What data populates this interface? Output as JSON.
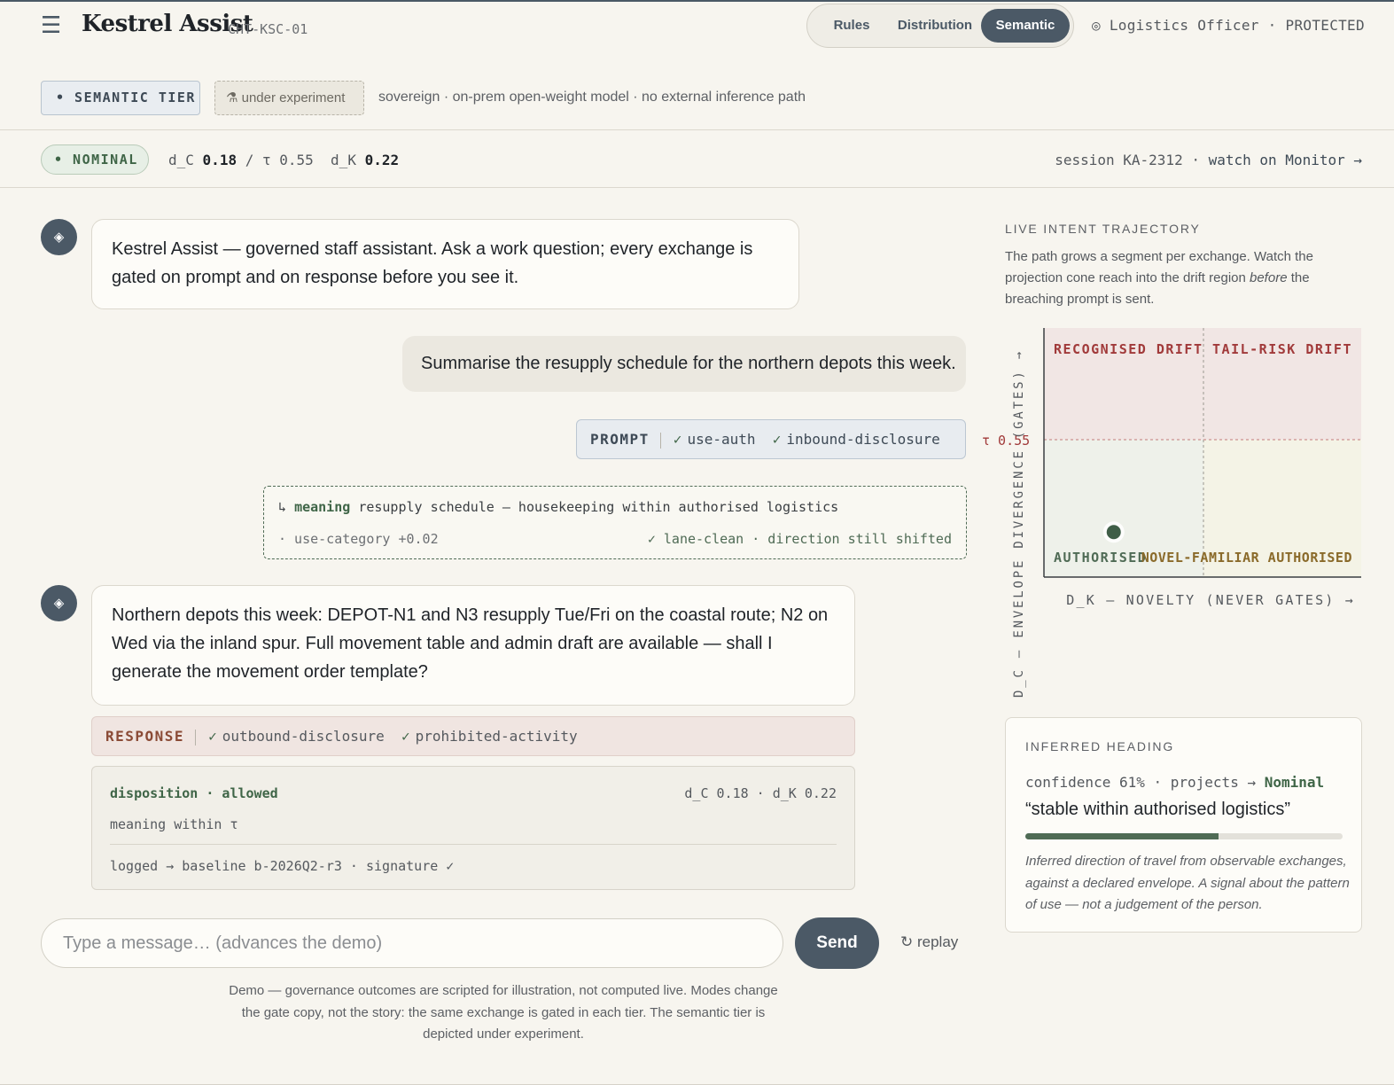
{
  "header": {
    "menu_icon": "☰",
    "app_title": "Kestrel Assist",
    "app_code": "CHT-KSC-01",
    "modes": [
      {
        "label": "Rules",
        "active": false
      },
      {
        "label": "Distribution",
        "active": false
      },
      {
        "label": "Semantic",
        "active": true
      }
    ],
    "user_icon": "◎",
    "user_role": "Logistics Officer · PROTECTED"
  },
  "tier": {
    "badge": "• SEMANTIC TIER",
    "experiment_icon": "⚗",
    "experiment_label": "under experiment",
    "description": "sovereign · on-prem open-weight model · no external inference path"
  },
  "status": {
    "badge": "• NOMINAL",
    "dc_label": "d_C",
    "dc_value": "0.18",
    "tau_text": "/ τ 0.55",
    "dk_label": "d_K",
    "dk_value": "0.22",
    "session": "session KA-2312 ·",
    "session_link": "watch on Monitor →"
  },
  "chat": {
    "assistant_icon": "◈",
    "intro": "Kestrel Assist — governed staff assistant. Ask a work question; every exchange is gated on prompt and on response before you see it.",
    "user_message": "Summarise the resupply schedule for the northern depots this week.",
    "prompt_gate": {
      "label": "PROMPT",
      "checks": [
        "use-auth",
        "inbound-disclosure"
      ]
    },
    "meaning": {
      "arrow": "↳",
      "label": "meaning",
      "text": "resupply schedule — housekeeping within authorised logistics",
      "category": "· use-category +0.02",
      "lane": "✓ lane-clean · direction still shifted"
    },
    "assistant_reply": "Northern depots this week: DEPOT-N1 and N3 resupply Tue/Fri on the coastal route; N2 on Wed via the inland spur. Full movement table and admin draft are available — shall I generate the movement order template?",
    "response_gate": {
      "label": "RESPONSE",
      "checks": [
        "outbound-disclosure",
        "prohibited-activity"
      ]
    },
    "disposition": {
      "title": "disposition · allowed",
      "metrics": "d_C 0.18 · d_K 0.22",
      "meaning": "meaning within τ",
      "log": "logged → baseline b-2026Q2-r3 · signature ✓"
    }
  },
  "composer": {
    "placeholder": "Type a message… (advances the demo)",
    "send_label": "Send",
    "replay_label": "↻ replay"
  },
  "footnote": "Demo — governance outcomes are scripted for illustration, not computed live. Modes change the gate copy, not the story: the same exchange is gated in each tier. The semantic tier is depicted under experiment.",
  "trajectory": {
    "title": "LIVE INTENT TRAJECTORY",
    "desc_before": "The path grows a segment per exchange. Watch the projection cone reach into the drift region ",
    "desc_em": "before",
    "desc_after": " the breaching prompt is sent."
  },
  "chart_data": {
    "type": "scatter",
    "xlabel": "D_K — NOVELTY (NEVER GATES) →",
    "ylabel": "D_C — ENVELOPE DIVERGENCE (GATES) →",
    "tau_label": "τ 0.55",
    "tau": 0.55,
    "quadrants": {
      "top_left": "RECOGNISED DRIFT",
      "top_right": "TAIL-RISK DRIFT",
      "bottom_left": "AUTHORISED",
      "bottom_right": "NOVEL-FAMILIAR AUTHORISED"
    },
    "points": [
      {
        "x": 0.22,
        "y": 0.18
      }
    ],
    "colors": {
      "drift": "#f1e6e4",
      "nominal": "#eef1ea",
      "novel": "#f4f3e6",
      "point": "#3f5e47",
      "drift_text": "#a13a3a",
      "auth_text": "#4f6b55",
      "novel_text": "#8a6a2a"
    }
  },
  "heading_card": {
    "title": "INFERRED HEADING",
    "confidence": "confidence 61% · projects →",
    "projects_to": "Nominal",
    "quote": "“stable within authorised logistics”",
    "confidence_fraction": 0.61,
    "note": "Inferred direction of travel from observable exchanges, against a declared envelope. A signal about the pattern of use — not a judgement of the person."
  }
}
